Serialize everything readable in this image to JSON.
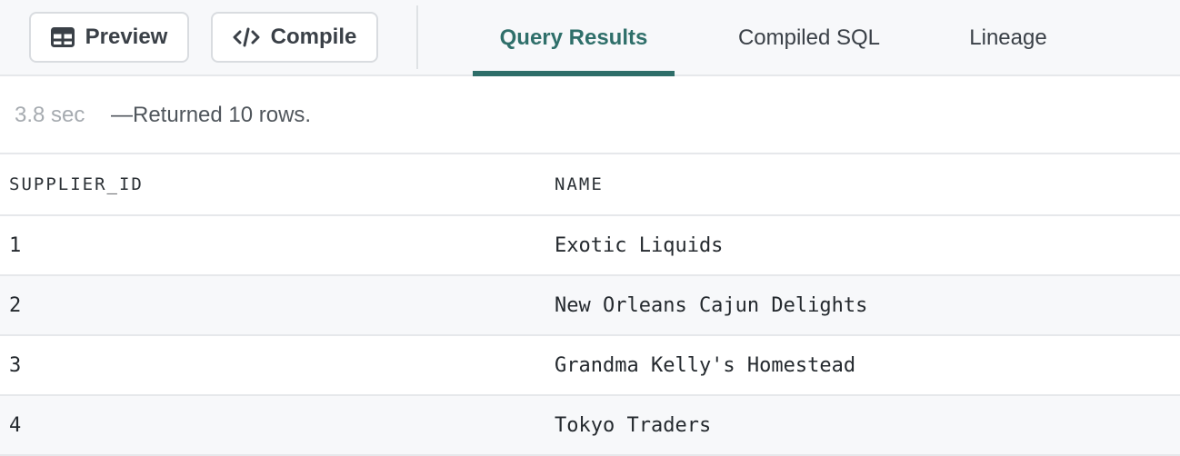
{
  "toolbar": {
    "preview_label": "Preview",
    "compile_label": "Compile",
    "tabs": [
      {
        "label": "Query Results",
        "active": true
      },
      {
        "label": "Compiled SQL",
        "active": false
      },
      {
        "label": "Lineage",
        "active": false
      }
    ],
    "accent_color": "#2e6e69"
  },
  "status": {
    "duration": "3.8 sec",
    "message": "—Returned 10 rows."
  },
  "table": {
    "columns": [
      "SUPPLIER_ID",
      "NAME"
    ],
    "rows": [
      [
        "1",
        "Exotic Liquids"
      ],
      [
        "2",
        "New Orleans Cajun Delights"
      ],
      [
        "3",
        "Grandma Kelly's Homestead"
      ],
      [
        "4",
        "Tokyo Traders"
      ]
    ]
  },
  "icons": {
    "preview": "table-icon",
    "compile": "code-icon"
  }
}
